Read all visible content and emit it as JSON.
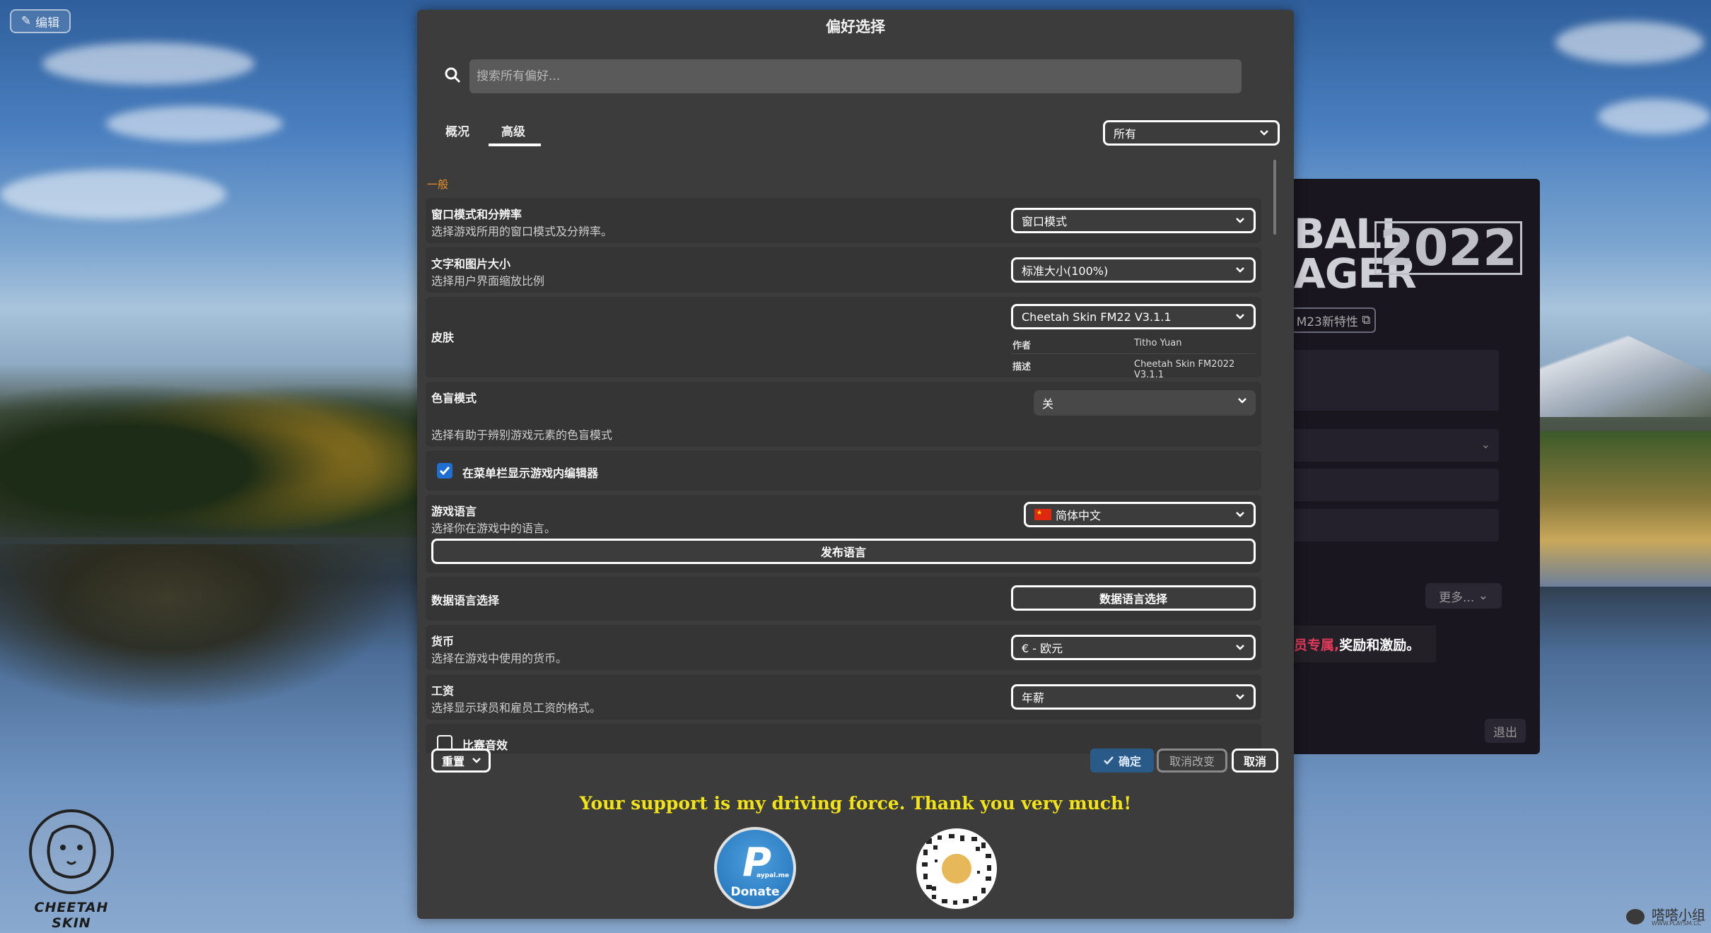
{
  "desktop": {
    "edit_button_label": "编辑",
    "logo_text": "CHEETAH SKIN",
    "watermark_text": "嗒嗒小组",
    "watermark_url": "WWW.PLAYSM.CC"
  },
  "background_app": {
    "brand_line1": "BALL",
    "brand_line2": "AGER",
    "brand_year": "2022",
    "new_features_label": "M23新特性",
    "more_label": "更多...",
    "promo_red": "员专属,",
    "promo_white": "奖励和激励。",
    "exit_label": "退出"
  },
  "dialog": {
    "title": "偏好选择",
    "search_placeholder": "搜索所有偏好...",
    "tabs": [
      "概况",
      "高级"
    ],
    "active_tab": "高级",
    "filter_value": "所有",
    "section_general": "一般",
    "window_mode": {
      "title": "窗口模式和分辨率",
      "subtitle": "选择游戏所用的窗口模式及分辨率。",
      "value": "窗口模式"
    },
    "text_size": {
      "title": "文字和图片大小",
      "subtitle": "选择用户界面缩放比例",
      "value": "标准大小(100%)"
    },
    "skin": {
      "title": "皮肤",
      "value": "Cheetah Skin FM22 V3.1.1",
      "author_label": "作者",
      "author_value": "Titho Yuan",
      "desc_label": "描述",
      "desc_value": "Cheetah Skin FM2022 V3.1.1"
    },
    "colorblind": {
      "title": "色盲模式",
      "subtitle": "选择有助于辨别游戏元素的色盲模式",
      "value": "关"
    },
    "show_editor": {
      "label": "在菜单栏显示游戏内编辑器",
      "checked": true
    },
    "game_language": {
      "title": "游戏语言",
      "subtitle": "选择你在游戏中的语言。",
      "value": "简体中文",
      "release_button": "发布语言"
    },
    "data_language": {
      "title": "数据语言选择",
      "button": "数据语言选择"
    },
    "currency": {
      "title": "货币",
      "subtitle": "选择在游戏中使用的货币。",
      "value": "€ - 欧元"
    },
    "wage": {
      "title": "工资",
      "subtitle": "选择显示球员和雇员工资的格式。",
      "value": "年薪"
    },
    "match_sound": {
      "label": "比赛音效",
      "checked": false
    },
    "footer": {
      "reset": "重置",
      "ok": "确定",
      "revert": "取消改变",
      "cancel": "取消"
    }
  },
  "donate": {
    "message": "Your support is my driving force. Thank you very much!",
    "paypal_small": "aypal.me",
    "paypal_label": "Donate"
  },
  "colors": {
    "accent_orange": "#e8902a",
    "support_yellow": "#f2e21a",
    "ok_blue": "#2a5a88",
    "check_blue": "#1e6fd0"
  }
}
